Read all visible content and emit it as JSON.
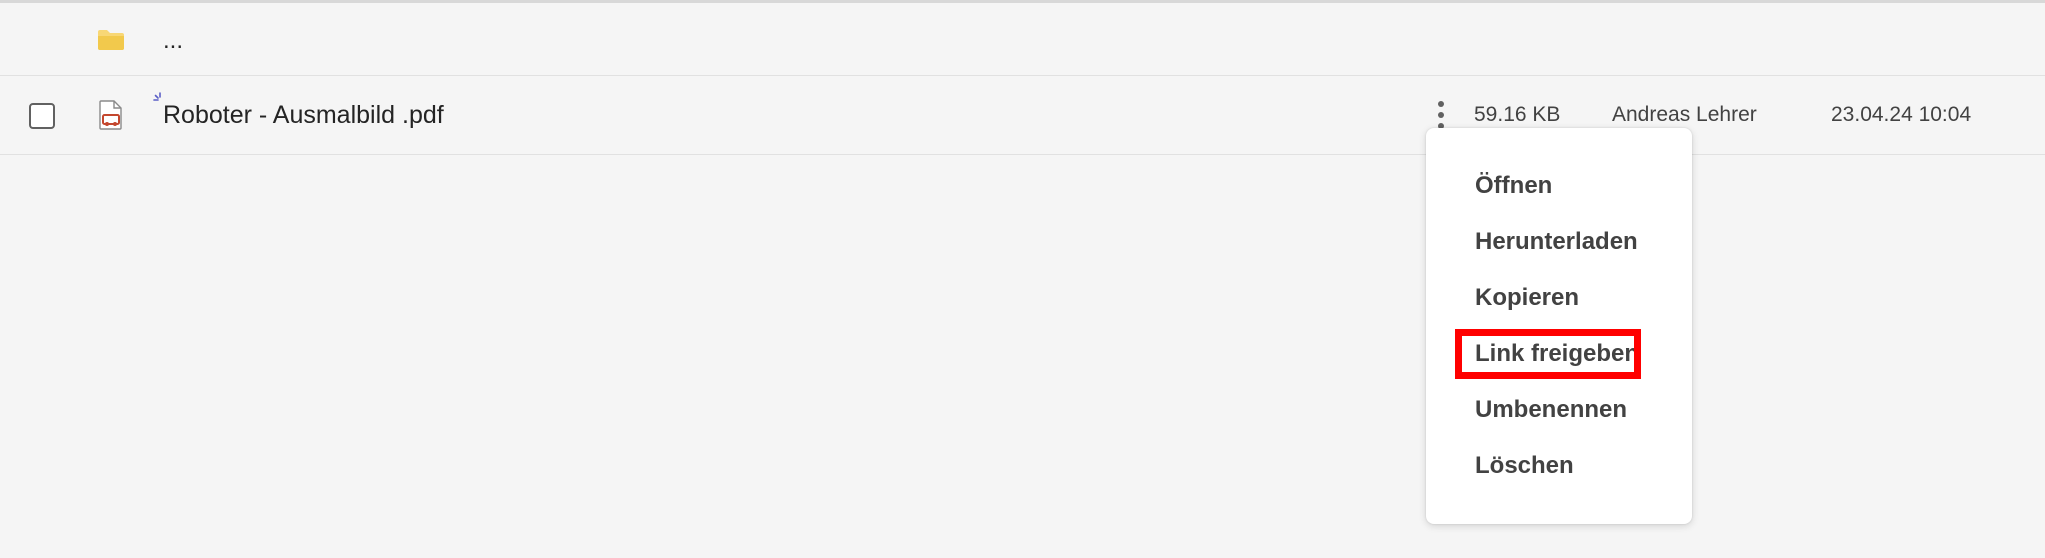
{
  "parent_row": {
    "label": "...",
    "icon": "folder-icon"
  },
  "file_row": {
    "name": "Roboter - Ausmalbild .pdf",
    "size": "59.16 KB",
    "owner": "Andreas Lehrer",
    "modified": "23.04.24 10:04",
    "icon": "pdf-file-icon",
    "checked": false
  },
  "context_menu": {
    "items": [
      {
        "label": "Öffnen"
      },
      {
        "label": "Herunterladen"
      },
      {
        "label": "Kopieren"
      },
      {
        "label": "Link freigeben"
      },
      {
        "label": "Umbenennen"
      },
      {
        "label": "Löschen"
      }
    ],
    "highlighted_item": "Link freigeben"
  },
  "colors": {
    "background": "#f5f5f5",
    "menu_background": "#ffffff",
    "highlight": "#ff0000",
    "folder": "#f8d775",
    "pdf_accent": "#c4472e"
  }
}
